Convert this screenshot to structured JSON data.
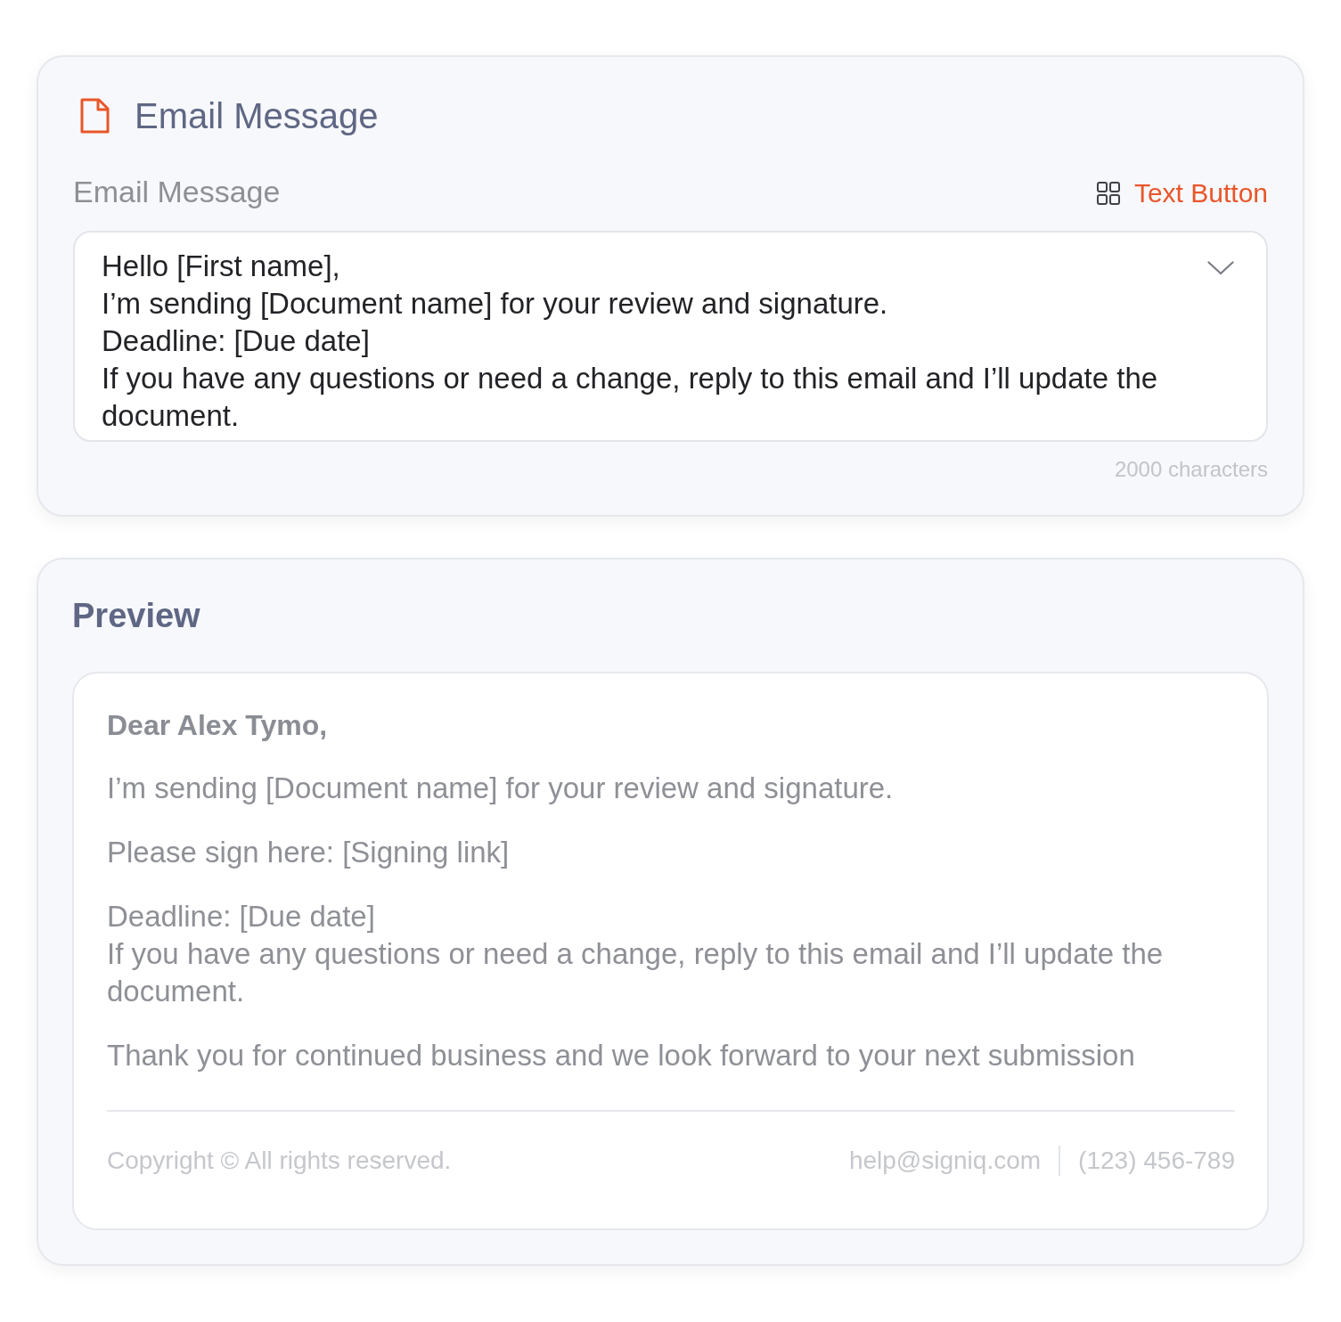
{
  "message_card": {
    "title": "Email Message",
    "field_label": "Email Message",
    "text_button": "Text Button",
    "message_lines": [
      "Hello [First name],",
      "I’m sending [Document name] for your review and signature.",
      "Deadline: [Due date]",
      "If you have any questions or need a change, reply to this email and I’ll update the document."
    ],
    "char_limit": "2000 characters"
  },
  "preview_card": {
    "title": "Preview",
    "greeting": "Dear Alex Tymo,",
    "paragraphs": [
      [
        "I’m sending [Document name] for your review and signature."
      ],
      [
        "Please sign here: [Signing link]"
      ],
      [
        "Deadline: [Due date]",
        "If you have any questions or need a change, reply to this email and I’ll update the document."
      ],
      [
        "Thank you for continued business and we look forward to your next submission"
      ]
    ],
    "footer": {
      "copyright": "Copyright © All rights reserved.",
      "email": "help@signiq.com",
      "phone": "(123) 456-789"
    }
  }
}
